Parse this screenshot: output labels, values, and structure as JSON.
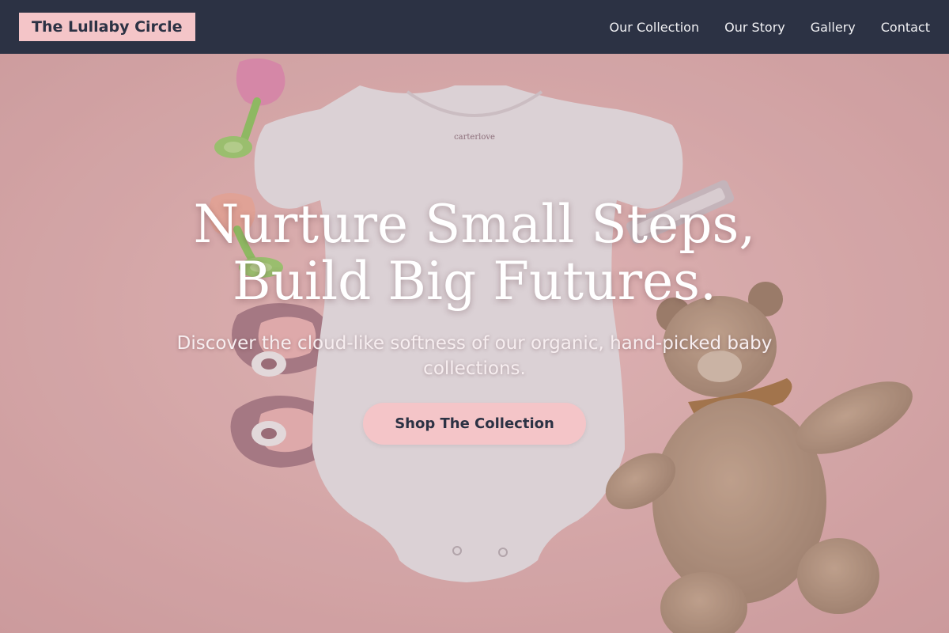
{
  "brand": {
    "name": "The Lullaby Circle"
  },
  "nav": {
    "links": [
      {
        "label": "Our Collection"
      },
      {
        "label": "Our Story"
      },
      {
        "label": "Gallery"
      },
      {
        "label": "Contact"
      }
    ]
  },
  "hero": {
    "title": "Nurture Small Steps, Build Big Futures.",
    "subtitle": "Discover the cloud-like softness of our organic, hand-picked baby collections.",
    "cta_label": "Shop The Collection",
    "onesie_tag": "carterlove"
  },
  "colors": {
    "nav_bg": "#2c3244",
    "accent_pink": "#f4c5c8",
    "hero_bg": "#e7b3b1"
  }
}
